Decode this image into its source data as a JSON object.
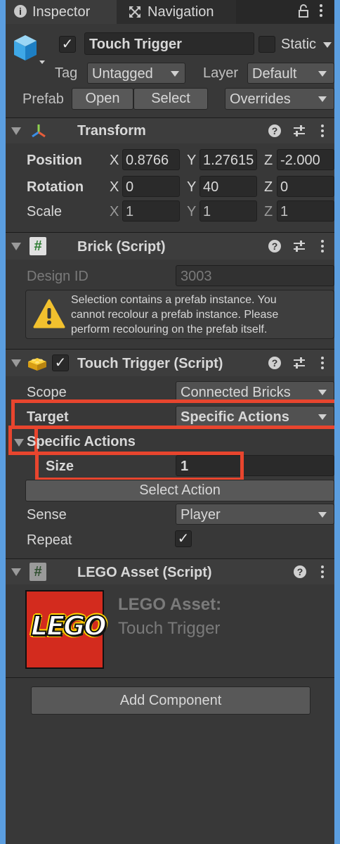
{
  "tabs": {
    "inspector": "Inspector",
    "navigation": "Navigation"
  },
  "object": {
    "name": "Touch Trigger",
    "active_checked": true,
    "static_label": "Static",
    "tag_label": "Tag",
    "tag_value": "Untagged",
    "layer_label": "Layer",
    "layer_value": "Default",
    "prefab_label": "Prefab",
    "open_label": "Open",
    "select_label": "Select",
    "overrides_label": "Overrides"
  },
  "transform": {
    "title": "Transform",
    "position_label": "Position",
    "rotation_label": "Rotation",
    "scale_label": "Scale",
    "axis_x": "X",
    "axis_y": "Y",
    "axis_z": "Z",
    "position": {
      "x": "0.8766",
      "y": "1.27615",
      "z": "-2.000"
    },
    "rotation": {
      "x": "0",
      "y": "40",
      "z": "0"
    },
    "scale": {
      "x": "1",
      "y": "1",
      "z": "1"
    }
  },
  "brick": {
    "title": "Brick (Script)",
    "design_id_label": "Design ID",
    "design_id_value": "3003",
    "warning_line1": "Selection contains a prefab instance. You",
    "warning_line2": "cannot recolour a prefab instance. Please",
    "warning_line3": "perform recolouring on the prefab itself."
  },
  "touch_trigger": {
    "title": "Touch Trigger (Script)",
    "enabled": true,
    "scope_label": "Scope",
    "scope_value": "Connected Bricks",
    "target_label": "Target",
    "target_value": "Specific Actions",
    "specific_actions_label": "Specific Actions",
    "size_label": "Size",
    "size_value": "1",
    "select_action_label": "Select Action",
    "sense_label": "Sense",
    "sense_value": "Player",
    "repeat_label": "Repeat",
    "repeat_checked": true
  },
  "lego_asset": {
    "title": "LEGO Asset (Script)",
    "logo_text": "LEGO",
    "asset_line1": "LEGO Asset:",
    "asset_line2": "Touch Trigger"
  },
  "add_component_label": "Add Component",
  "colors": {
    "highlight": "#e8452e",
    "frame": "#5b9ee0",
    "panel": "#383838",
    "lego_red": "#d32b1e",
    "lego_yellow": "#ffd500"
  }
}
